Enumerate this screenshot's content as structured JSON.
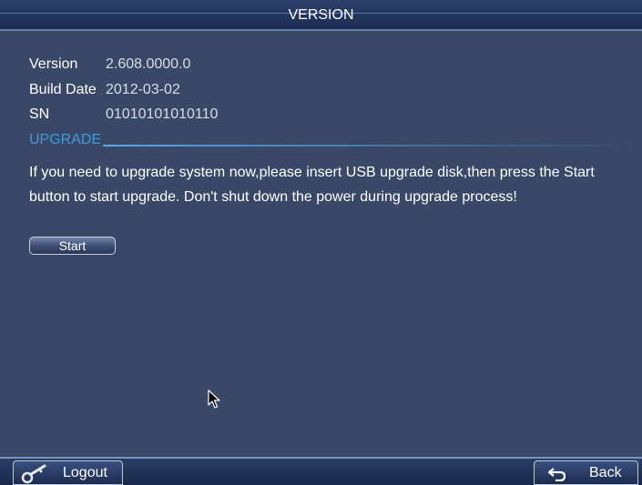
{
  "window": {
    "title": "VERSION"
  },
  "info": {
    "version_label": "Version",
    "version_value": "2.608.0000.0",
    "build_label": "Build Date",
    "build_value": "2012-03-02",
    "sn_label": "SN",
    "sn_value": "01010101010110"
  },
  "upgrade": {
    "section_title": "UPGRADE",
    "description": "If you need to upgrade system now,please insert USB upgrade disk,then press the Start button to start upgrade. Don't shut down the power during upgrade process!",
    "start_label": "Start"
  },
  "footer": {
    "logout_label": "Logout",
    "back_label": "Back"
  },
  "icons": {
    "logout": "key-icon",
    "back": "back-arrow-icon",
    "cursor": "mouse-pointer-icon"
  },
  "colors": {
    "background": "#3a4868",
    "accent": "#3f9bdc",
    "titlebar": "#1e3158"
  }
}
